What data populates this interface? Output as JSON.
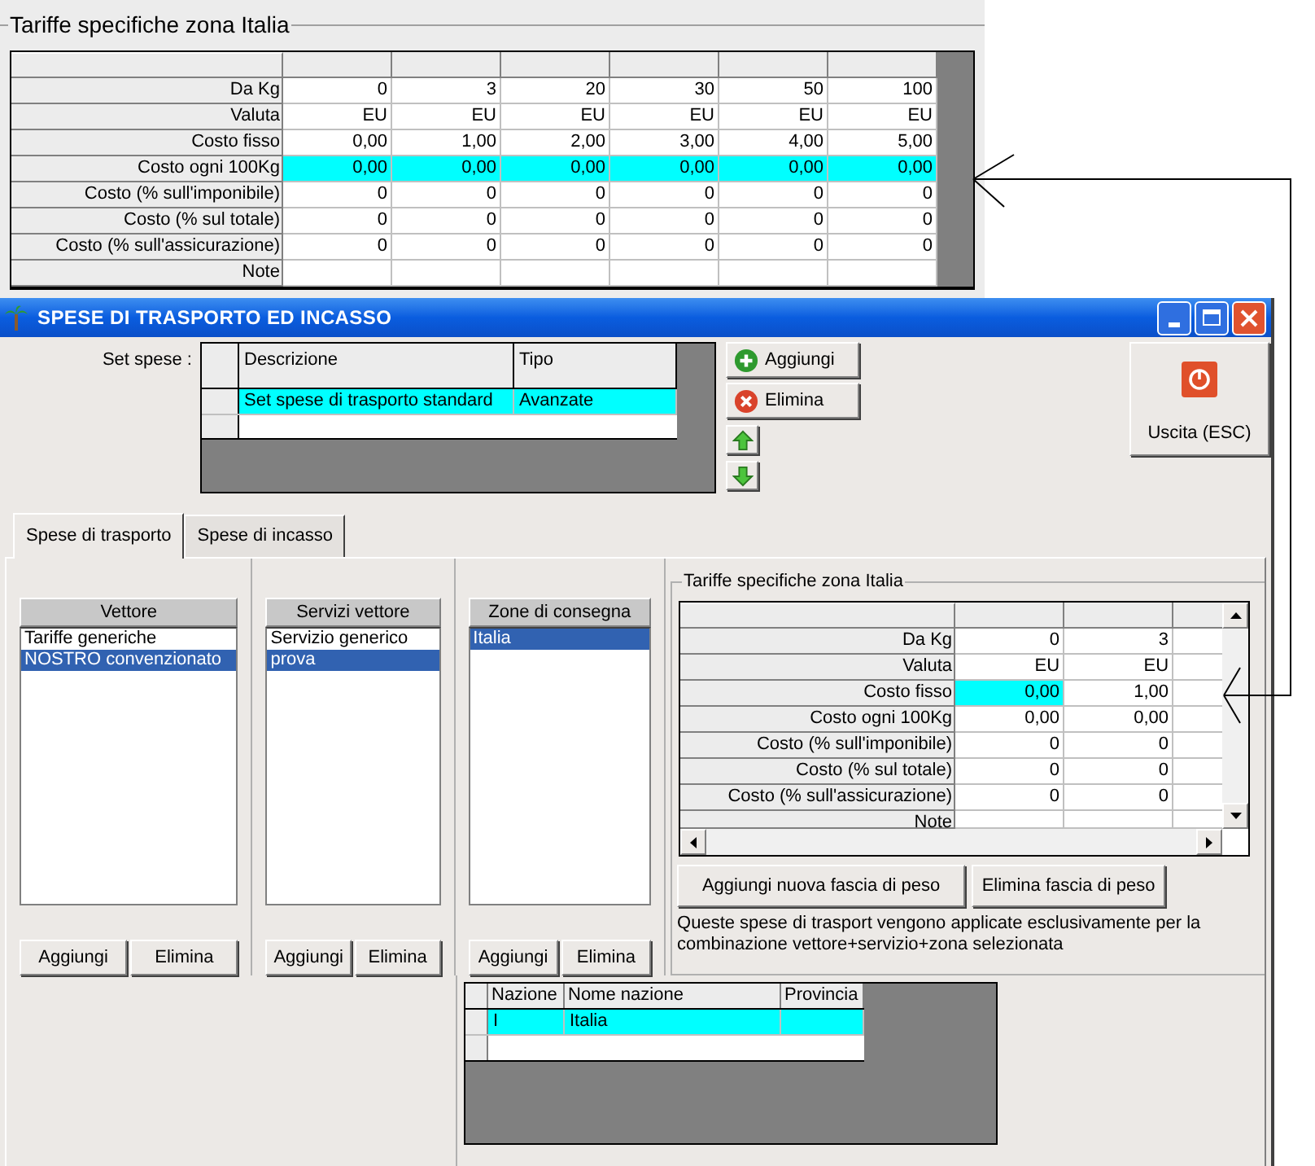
{
  "top_panel": {
    "title": "Tariffe specifiche zona Italia",
    "rows": [
      {
        "label": "Da Kg",
        "cells": [
          "0",
          "3",
          "20",
          "30",
          "50",
          "100"
        ],
        "selected": false
      },
      {
        "label": "Valuta",
        "cells": [
          "EU",
          "EU",
          "EU",
          "EU",
          "EU",
          "EU"
        ],
        "selected": false
      },
      {
        "label": "Costo fisso",
        "cells": [
          "0,00",
          "1,00",
          "2,00",
          "3,00",
          "4,00",
          "5,00"
        ],
        "selected": false
      },
      {
        "label": "Costo ogni 100Kg",
        "cells": [
          "0,00",
          "0,00",
          "0,00",
          "0,00",
          "0,00",
          "0,00"
        ],
        "selected": true
      },
      {
        "label": "Costo (% sull'imponibile)",
        "cells": [
          "0",
          "0",
          "0",
          "0",
          "0",
          "0"
        ],
        "selected": false
      },
      {
        "label": "Costo (% sul totale)",
        "cells": [
          "0",
          "0",
          "0",
          "0",
          "0",
          "0"
        ],
        "selected": false
      },
      {
        "label": "Costo (% sull'assicurazione)",
        "cells": [
          "0",
          "0",
          "0",
          "0",
          "0",
          "0"
        ],
        "selected": false
      },
      {
        "label": "Note",
        "cells": [],
        "selected": false
      }
    ]
  },
  "window": {
    "title": "SPESE DI TRASPORTO ED INCASSO"
  },
  "set_spese": {
    "label": "Set spese :",
    "columns": [
      "Descrizione",
      "Tipo"
    ],
    "rows": [
      {
        "cells": [
          "Set spese di trasporto standard",
          "Avanzate"
        ],
        "selected": true
      }
    ]
  },
  "set_buttons": [
    {
      "kind": "add",
      "label": "Aggiungi"
    },
    {
      "kind": "delete",
      "label": "Elimina"
    },
    {
      "kind": "up"
    },
    {
      "kind": "down"
    }
  ],
  "exit_button": {
    "label": "Uscita (ESC)"
  },
  "tabs": [
    {
      "label": "Spese di trasporto",
      "selected": true
    },
    {
      "label": "Spese di incasso",
      "selected": false
    }
  ],
  "lists": [
    {
      "title": "Vettore",
      "items": [
        {
          "label": "Tariffe generiche",
          "selected": false
        },
        {
          "label": "NOSTRO convenzionato",
          "selected": true
        }
      ],
      "buttons": [
        "Aggiungi",
        "Elimina"
      ]
    },
    {
      "title": "Servizi vettore",
      "items": [
        {
          "label": "Servizio generico",
          "selected": false
        },
        {
          "label": "prova",
          "selected": true
        }
      ],
      "buttons": [
        "Aggiungi",
        "Elimina"
      ]
    },
    {
      "title": "Zone di consegna",
      "items": [
        {
          "label": "Italia",
          "selected": true
        }
      ],
      "buttons": [
        "Aggiungi",
        "Elimina"
      ]
    }
  ],
  "zone_rates": {
    "title": "Tariffe specifiche zona Italia",
    "rows": [
      {
        "label": "Da Kg",
        "cells": [
          {
            "text": "0",
            "selected": false
          },
          {
            "text": "3",
            "selected": false
          }
        ]
      },
      {
        "label": "Valuta",
        "cells": [
          {
            "text": "EU",
            "selected": false
          },
          {
            "text": "EU",
            "selected": false
          }
        ]
      },
      {
        "label": "Costo fisso",
        "cells": [
          {
            "text": "0,00",
            "selected": true
          },
          {
            "text": "1,00",
            "selected": false
          }
        ]
      },
      {
        "label": "Costo ogni 100Kg",
        "cells": [
          {
            "text": "0,00",
            "selected": false
          },
          {
            "text": "0,00",
            "selected": false
          }
        ]
      },
      {
        "label": "Costo (% sull'imponibile)",
        "cells": [
          {
            "text": "0",
            "selected": false
          },
          {
            "text": "0",
            "selected": false
          }
        ]
      },
      {
        "label": "Costo (% sul totale)",
        "cells": [
          {
            "text": "0",
            "selected": false
          },
          {
            "text": "0",
            "selected": false
          }
        ]
      },
      {
        "label": "Costo (% sull'assicurazione)",
        "cells": [
          {
            "text": "0",
            "selected": false
          },
          {
            "text": "0",
            "selected": false
          }
        ]
      },
      {
        "label": "Note",
        "cells": []
      }
    ],
    "buttons": [
      "Aggiungi nuova fascia di peso",
      "Elimina fascia di peso"
    ],
    "note": "Queste spese di trasport vengono applicate esclusivamente per la combinazione vettore+servizio+zona selezionata"
  },
  "nations": {
    "columns": [
      "Nazione",
      "Nome nazione",
      "Provincia"
    ],
    "rows": [
      {
        "cells": [
          "I",
          "Italia"
        ],
        "selected": true
      }
    ]
  }
}
